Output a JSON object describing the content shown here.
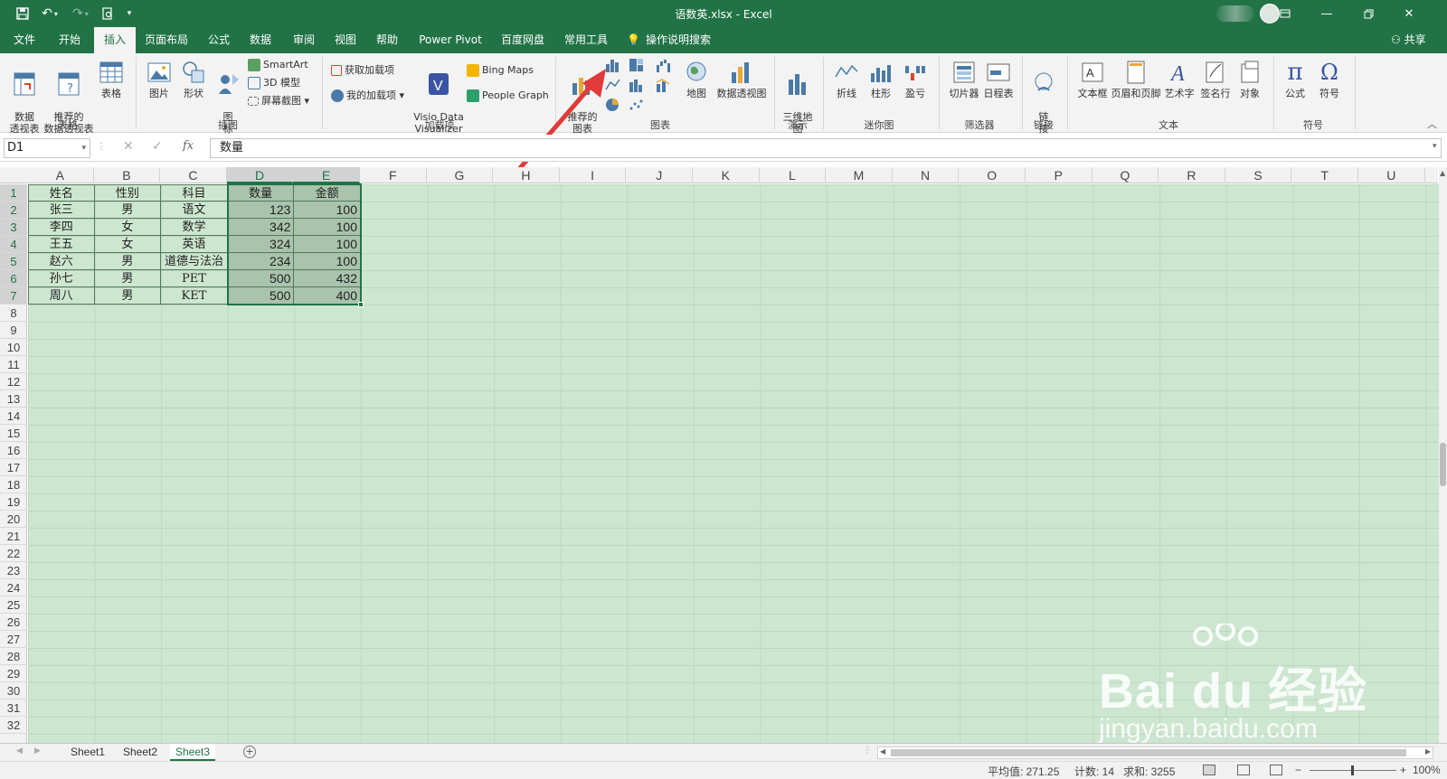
{
  "window": {
    "title": "语数英.xlsx - Excel",
    "accent": "#217346"
  },
  "quick_access": {
    "icons": [
      "save-icon",
      "undo-icon",
      "redo-icon",
      "print-preview-icon",
      "customize-icon"
    ]
  },
  "tabs": [
    "文件",
    "开始",
    "插入",
    "页面布局",
    "公式",
    "数据",
    "审阅",
    "视图",
    "帮助",
    "Power Pivot",
    "百度网盘",
    "常用工具"
  ],
  "active_tab": "插入",
  "tell_me": "操作说明搜索",
  "share": "共享",
  "ribbon": {
    "tables": {
      "pivot": "数据\n透视表",
      "recommended_pivot": "推荐的\n数据透视表",
      "table": "表格",
      "group": "表格"
    },
    "illustrations": {
      "picture": "图片",
      "shapes": "形状",
      "icons": "图\n标",
      "smartart": "SmartArt",
      "model3d": "3D 模型",
      "screenshot": "屏幕截图",
      "group": "插图"
    },
    "addins": {
      "get": "获取加载项",
      "mine": "我的加载项",
      "visio": "Visio Data\nVisualizer",
      "bing": "Bing Maps",
      "people": "People Graph",
      "group": "加载项"
    },
    "charts": {
      "recommended": "推荐的\n图表",
      "map": "地图",
      "pivot_chart": "数据透视图",
      "group": "图表"
    },
    "tours": {
      "map3d": "三维地\n图",
      "group": "演示"
    },
    "sparklines": {
      "line": "折线",
      "column": "柱形",
      "winloss": "盈亏",
      "group": "迷你图"
    },
    "filters": {
      "slicer": "切片器",
      "timeline": "日程表",
      "group": "筛选器"
    },
    "links": {
      "link": "链\n接",
      "group": "链接"
    },
    "text": {
      "textbox": "文本框",
      "header": "页眉和页脚",
      "wordart": "艺术字",
      "signature": "签名行",
      "object": "对象",
      "group": "文本"
    },
    "symbols": {
      "equation": "公式",
      "symbol": "符号",
      "group": "符号"
    }
  },
  "formula_bar": {
    "name_box": "D1",
    "fx": "fx",
    "value": "数量"
  },
  "columns": [
    "A",
    "B",
    "C",
    "D",
    "E",
    "F",
    "G",
    "H",
    "I",
    "J",
    "K",
    "L",
    "M",
    "N",
    "O",
    "P",
    "Q",
    "R",
    "S",
    "T",
    "U"
  ],
  "rows": [
    "1",
    "2",
    "3",
    "4",
    "5",
    "6",
    "7",
    "8",
    "9",
    "10",
    "11",
    "12",
    "13",
    "14",
    "15",
    "16",
    "17",
    "18",
    "19",
    "20",
    "21",
    "22",
    "23",
    "24",
    "25",
    "26",
    "27",
    "28",
    "29",
    "30",
    "31",
    "32"
  ],
  "table": {
    "headers": [
      "姓名",
      "性别",
      "科目",
      "数量",
      "金额"
    ],
    "rows": [
      [
        "张三",
        "男",
        "语文",
        "123",
        "100"
      ],
      [
        "李四",
        "女",
        "数学",
        "342",
        "100"
      ],
      [
        "王五",
        "女",
        "英语",
        "324",
        "100"
      ],
      [
        "赵六",
        "男",
        "道德与法治",
        "234",
        "100"
      ],
      [
        "孙七",
        "男",
        "PET",
        "500",
        "432"
      ],
      [
        "周八",
        "男",
        "KET",
        "500",
        "400"
      ]
    ]
  },
  "sheets": [
    "Sheet1",
    "Sheet2",
    "Sheet3"
  ],
  "active_sheet": "Sheet3",
  "status": {
    "average": "平均值: 271.25",
    "count": "计数: 14",
    "sum": "求和: 3255",
    "zoom": "100%"
  },
  "watermark": {
    "main": "Bai du 经验",
    "sub": "jingyan.baidu.com"
  }
}
